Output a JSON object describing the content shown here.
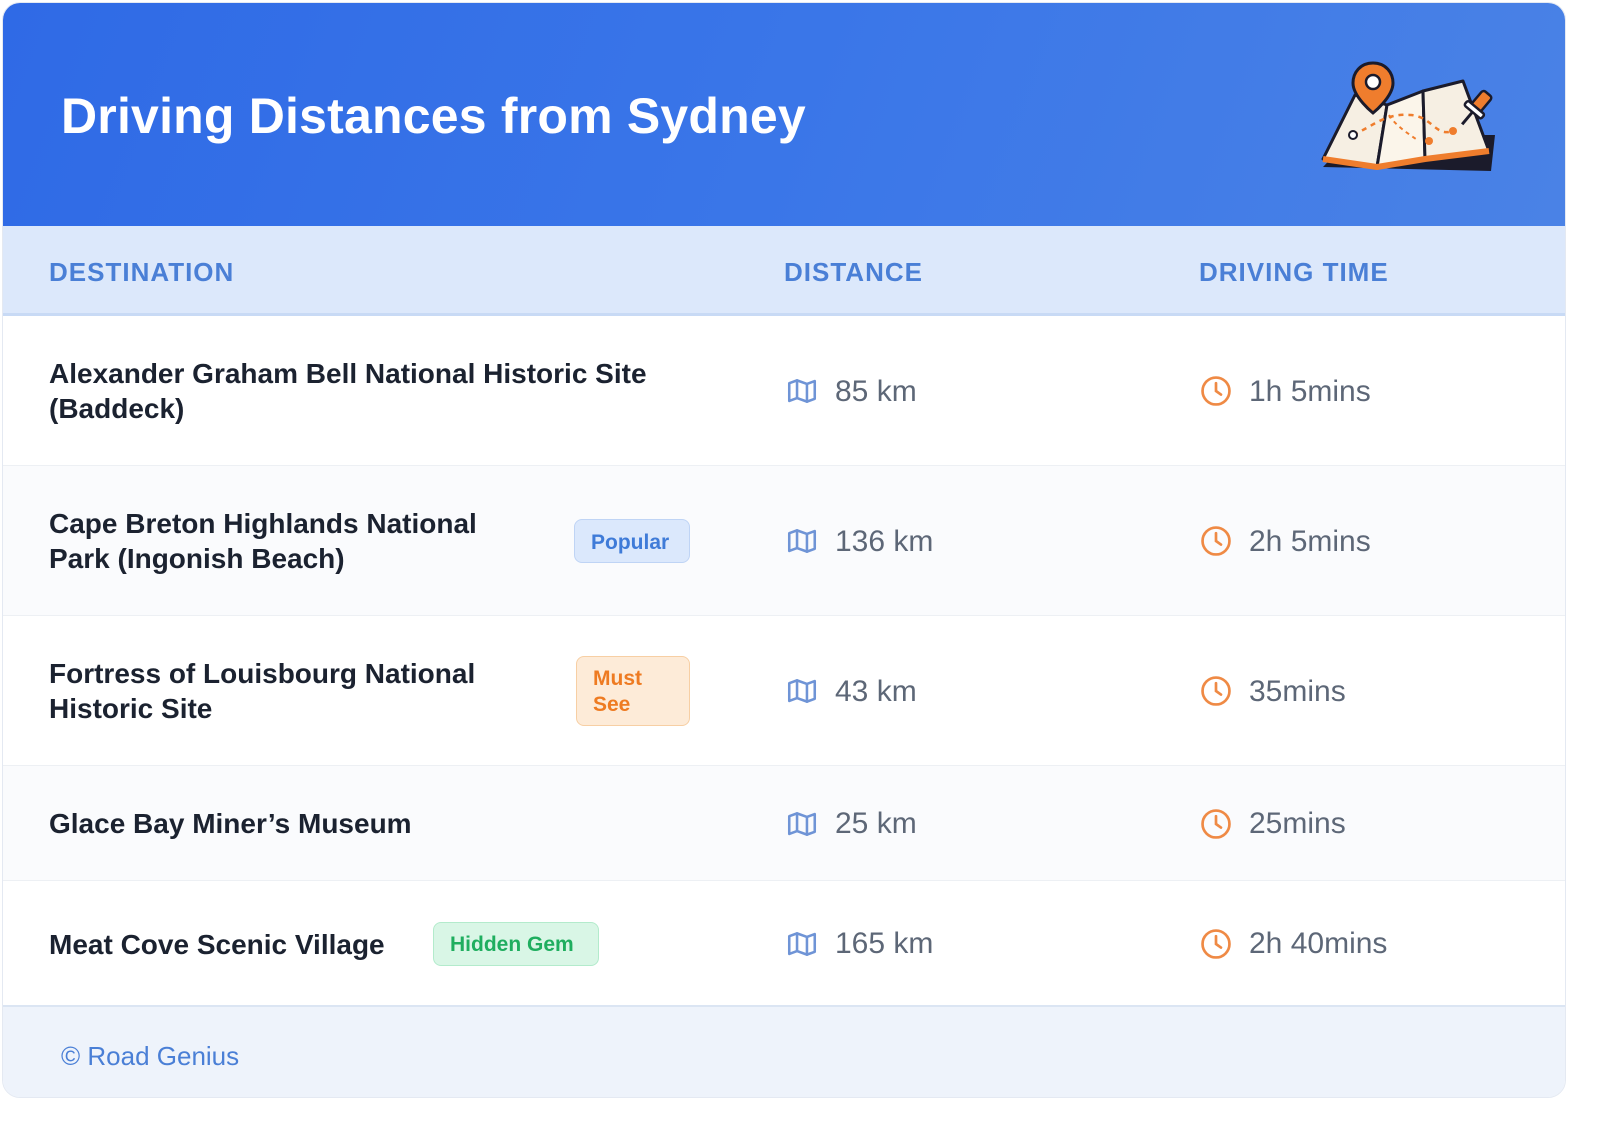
{
  "header": {
    "title": "Driving Distances from Sydney",
    "illustration_icon": "folded-map-with-location-pin-icon",
    "gradient_colors": [
      "#2f6ae6",
      "#4a82e6"
    ]
  },
  "table": {
    "columns": [
      "DESTINATION",
      "DISTANCE",
      "DRIVING TIME"
    ],
    "distance_icon": "map-icon",
    "time_icon": "clock-icon",
    "rows": [
      {
        "destination_lines": [
          "Alexander Graham Bell National Historic Site",
          "(Baddeck)"
        ],
        "badge": null,
        "distance": "85 km",
        "driving_time": "1h 5mins"
      },
      {
        "destination_lines": [
          "Cape Breton Highlands National",
          "Park (Ingonish Beach)"
        ],
        "badge": {
          "lines": [
            "Popular"
          ],
          "style": "popular"
        },
        "distance": "136 km",
        "driving_time": "2h 5mins"
      },
      {
        "destination_lines": [
          "Fortress of Louisbourg National",
          "Historic Site"
        ],
        "badge": {
          "lines": [
            "Must",
            "See"
          ],
          "style": "mustsee"
        },
        "distance": "43 km",
        "driving_time": "35mins"
      },
      {
        "destination_lines": [
          "Glace Bay Miner’s Museum"
        ],
        "badge": null,
        "distance": "25 km",
        "driving_time": "25mins"
      },
      {
        "destination_lines": [
          "Meat Cove Scenic Village"
        ],
        "badge": {
          "lines": [
            "Hidden Gem"
          ],
          "style": "hidden"
        },
        "distance": "165 km",
        "driving_time": "2h 40mins"
      }
    ]
  },
  "footer": {
    "credit": "© Road Genius"
  },
  "colors": {
    "accent_blue": "#4a7fd6",
    "map_icon_color": "#6f94d6",
    "clock_icon_color": "#ef8a45",
    "popular_badge": "#3f7bd8",
    "mustsee_badge": "#ee7b22",
    "hidden_gem_badge": "#1fae5f"
  }
}
